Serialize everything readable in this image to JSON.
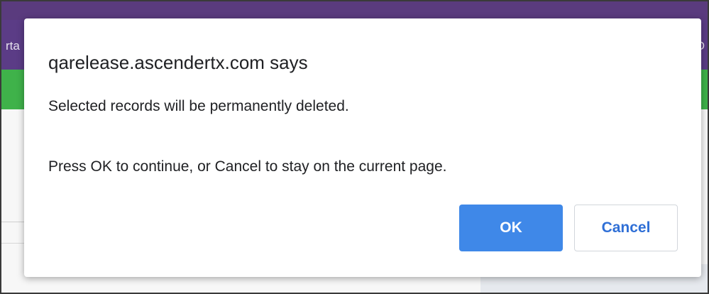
{
  "background": {
    "nav_left_fragment": "rta",
    "nav_right_fragment": "D",
    "colors": {
      "purple_bar": "#5b3c86",
      "green_bar": "#3fb24a"
    }
  },
  "dialog": {
    "title": "qarelease.ascendertx.com says",
    "message_line1": "Selected records will be permanently deleted.",
    "message_line2": "Press OK to continue, or Cancel to stay on the current page.",
    "ok_label": "OK",
    "cancel_label": "Cancel",
    "colors": {
      "ok_bg": "#3f88e8",
      "cancel_text": "#2f6fd6"
    }
  }
}
